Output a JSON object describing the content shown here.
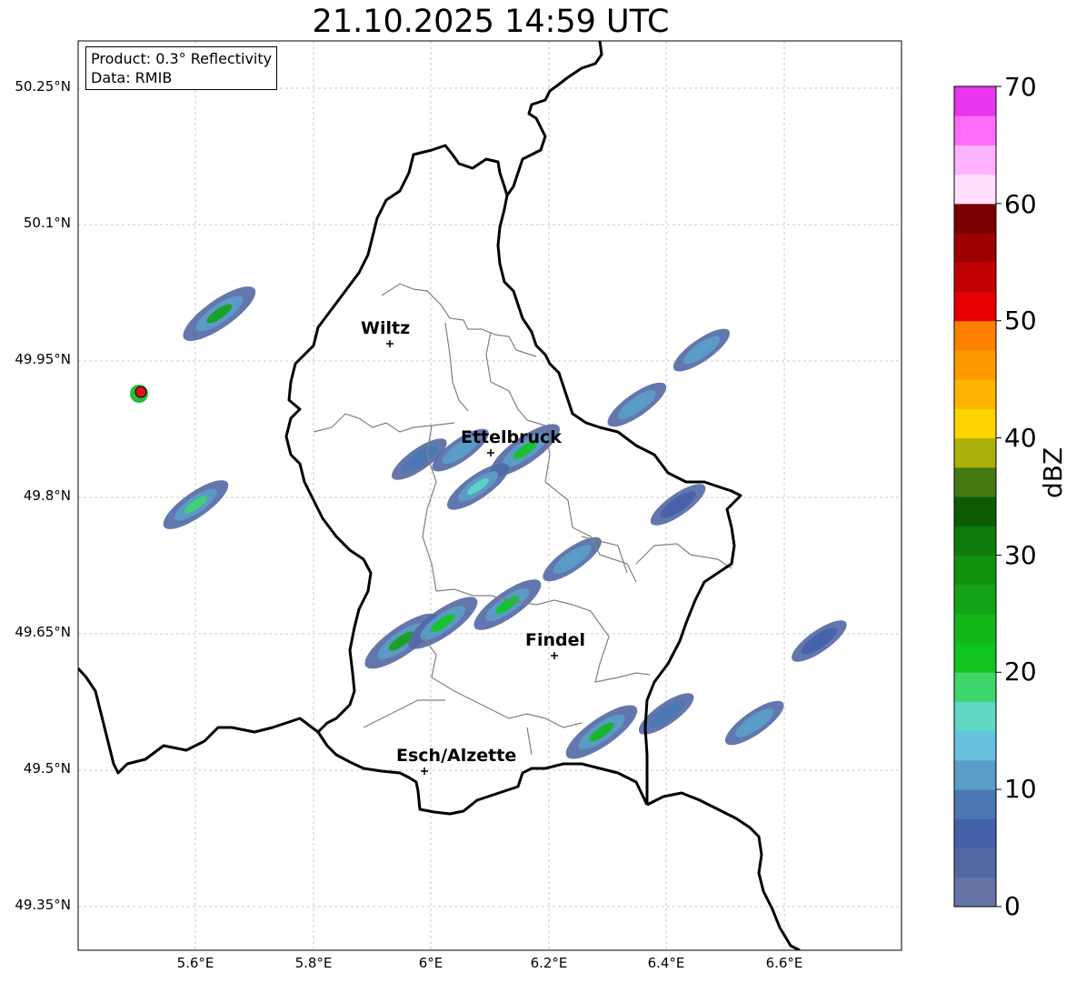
{
  "title": "21.10.2025 14:59 UTC",
  "info": {
    "product": "Product: 0.3° Reflectivity",
    "data": "Data: RMIB"
  },
  "latitude_labels": [
    "50.25°N",
    "50.1°N",
    "49.95°N",
    "49.8°N",
    "49.65°N",
    "49.5°N",
    "49.35°N"
  ],
  "longitude_labels": [
    "5.6°E",
    "5.8°E",
    "6°E",
    "6.2°E",
    "6.4°E",
    "6.6°E"
  ],
  "places": [
    {
      "name": "Wiltz",
      "lon": 5.93,
      "lat": 49.97
    },
    {
      "name": "Ettelbruck",
      "lon": 6.1,
      "lat": 49.85
    },
    {
      "name": "Findel",
      "lon": 6.21,
      "lat": 49.63
    },
    {
      "name": "Esch/Alzette",
      "lon": 5.99,
      "lat": 49.5
    }
  ],
  "colorbar": {
    "label": "dBZ",
    "ticks": [
      "0",
      "10",
      "20",
      "30",
      "40",
      "50",
      "60",
      "70"
    ],
    "range": [
      0,
      70
    ],
    "colors": [
      "#6674a8",
      "#5268a5",
      "#4561a8",
      "#4b78b3",
      "#5b9dc9",
      "#66c1dc",
      "#5fd7c4",
      "#3dd66c",
      "#10c51f",
      "#13b719",
      "#12a216",
      "#10910e",
      "#0f7b0c",
      "#0c5c06",
      "#457a12",
      "#adb008",
      "#ffd500",
      "#ffb500",
      "#ff9a00",
      "#ff7f00",
      "#e60002",
      "#c10001",
      "#9c0001",
      "#7a0000",
      "#ffe0ff",
      "#ffb3ff",
      "#ff6cf9",
      "#ea36ee"
    ]
  },
  "map_extent": {
    "lon": [
      5.4,
      6.8
    ],
    "lat": [
      49.3,
      50.3
    ]
  },
  "radar_site": {
    "lon": 5.505,
    "lat": 49.914
  },
  "echoes": [
    {
      "lon": 6.05,
      "lat": 49.85,
      "dbz": 10
    },
    {
      "lon": 5.98,
      "lat": 49.84,
      "dbz": 8
    },
    {
      "lon": 6.16,
      "lat": 49.85,
      "dbz": 22
    },
    {
      "lon": 6.08,
      "lat": 49.81,
      "dbz": 15
    },
    {
      "lon": 6.24,
      "lat": 49.73,
      "dbz": 12
    },
    {
      "lon": 6.42,
      "lat": 49.79,
      "dbz": 6
    },
    {
      "lon": 6.35,
      "lat": 49.9,
      "dbz": 12
    },
    {
      "lon": 6.46,
      "lat": 49.96,
      "dbz": 10
    },
    {
      "lon": 5.95,
      "lat": 49.64,
      "dbz": 26
    },
    {
      "lon": 6.02,
      "lat": 49.66,
      "dbz": 22
    },
    {
      "lon": 6.13,
      "lat": 49.68,
      "dbz": 20
    },
    {
      "lon": 6.29,
      "lat": 49.54,
      "dbz": 24
    },
    {
      "lon": 6.4,
      "lat": 49.56,
      "dbz": 8
    },
    {
      "lon": 6.55,
      "lat": 49.55,
      "dbz": 12
    },
    {
      "lon": 6.66,
      "lat": 49.64,
      "dbz": 6
    },
    {
      "lon": 5.6,
      "lat": 49.79,
      "dbz": 18
    },
    {
      "lon": 5.64,
      "lat": 50.0,
      "dbz": 25
    }
  ]
}
